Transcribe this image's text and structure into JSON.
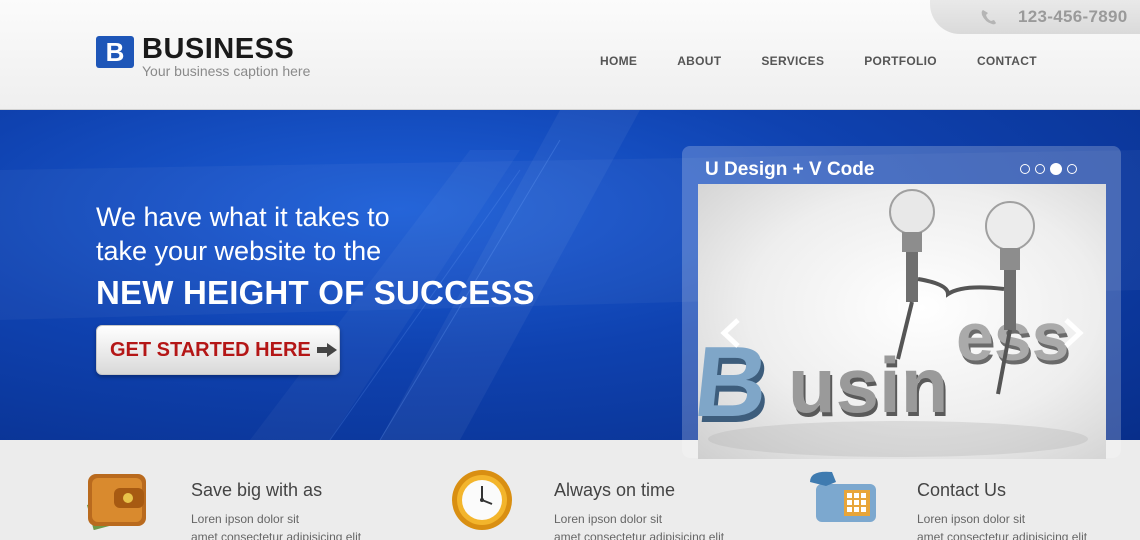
{
  "header": {
    "phone": "123-456-7890",
    "logo_mark": "B",
    "logo_title": "BUSINESS",
    "logo_caption": "Your business caption here",
    "nav": [
      "HOME",
      "ABOUT",
      "SERVICES",
      "PORTFOLIO",
      "CONTACT"
    ]
  },
  "hero": {
    "line1": "We have what it takes to",
    "line2": "take your website to the",
    "line3": "NEW HEIGHT OF SUCCESS",
    "cta_label": "GET STARTED HERE"
  },
  "slider": {
    "title": "U Design + V Code",
    "active_dot": 3,
    "dot_count": 4,
    "slide_word": "Business"
  },
  "features": [
    {
      "title": "Save big with as",
      "line1": "Loren ipson dolor sit",
      "line2": "amet consectetur adipisicing elit"
    },
    {
      "title": "Always on time",
      "line1": "Loren ipson dolor sit",
      "line2": "amet consectetur adipisicing elit"
    },
    {
      "title": "Contact Us",
      "line1": "Loren ipson dolor sit",
      "line2": "amet consectetur adipisicing elit"
    }
  ],
  "colors": {
    "brand_blue": "#1e56b8",
    "cta_red": "#b41616",
    "hero_blue": "#0f42b0"
  }
}
